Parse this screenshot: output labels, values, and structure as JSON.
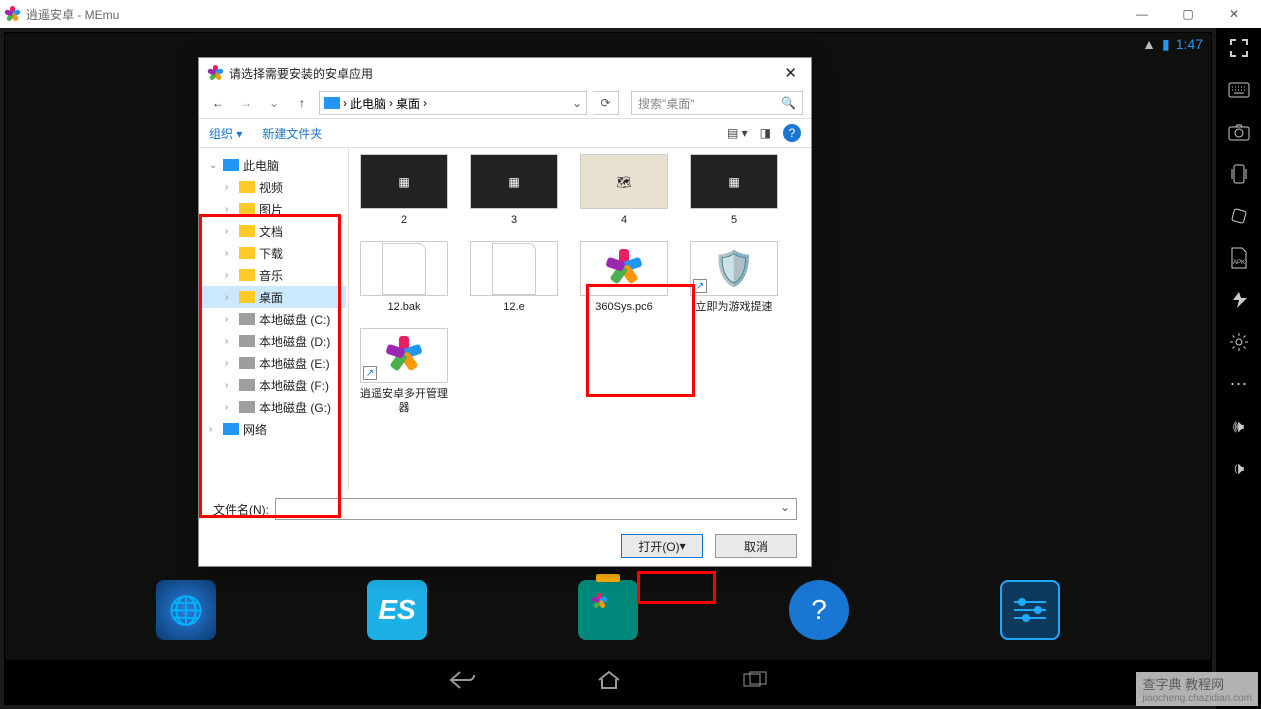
{
  "window": {
    "title": "逍遥安卓 - MEmu"
  },
  "android": {
    "clock": "1:47"
  },
  "dialog": {
    "title": "请选择需要安装的安卓应用",
    "breadcrumb": {
      "root": "此电脑",
      "current": "桌面"
    },
    "search_placeholder": "搜索\"桌面\"",
    "toolbar": {
      "organize": "组织",
      "newfolder": "新建文件夹"
    },
    "tree": [
      {
        "label": "此电脑",
        "icon": "pc",
        "level": 1,
        "expanded": true
      },
      {
        "label": "视频",
        "icon": "folder",
        "level": 2
      },
      {
        "label": "图片",
        "icon": "folder",
        "level": 2
      },
      {
        "label": "文档",
        "icon": "folder",
        "level": 2
      },
      {
        "label": "下载",
        "icon": "folder",
        "level": 2
      },
      {
        "label": "音乐",
        "icon": "folder",
        "level": 2
      },
      {
        "label": "桌面",
        "icon": "folder",
        "level": 2,
        "selected": true
      },
      {
        "label": "本地磁盘 (C:)",
        "icon": "drive",
        "level": 2
      },
      {
        "label": "本地磁盘 (D:)",
        "icon": "drive",
        "level": 2
      },
      {
        "label": "本地磁盘 (E:)",
        "icon": "drive",
        "level": 2
      },
      {
        "label": "本地磁盘 (F:)",
        "icon": "drive",
        "level": 2
      },
      {
        "label": "本地磁盘 (G:)",
        "icon": "drive",
        "level": 2
      },
      {
        "label": "网络",
        "icon": "net",
        "level": 1
      }
    ],
    "files": [
      {
        "name": "2",
        "kind": "img-dark"
      },
      {
        "name": "3",
        "kind": "img-dark"
      },
      {
        "name": "4",
        "kind": "img-map"
      },
      {
        "name": "5",
        "kind": "img-dark"
      },
      {
        "name": "12.bak",
        "kind": "doc"
      },
      {
        "name": "12.e",
        "kind": "doc"
      },
      {
        "name": "360Sys.pc6",
        "kind": "logo"
      },
      {
        "name": "立即为游戏提速",
        "kind": "shield",
        "shortcut": true
      },
      {
        "name": "逍遥安卓多开管理器",
        "kind": "logo",
        "shortcut": true
      }
    ],
    "filename_label": "文件名(N):",
    "open_btn": "打开(O)",
    "cancel_btn": "取消"
  },
  "watermark": {
    "main": "查字典 教程网",
    "sub": "jiaocheng.chazidian.com"
  }
}
